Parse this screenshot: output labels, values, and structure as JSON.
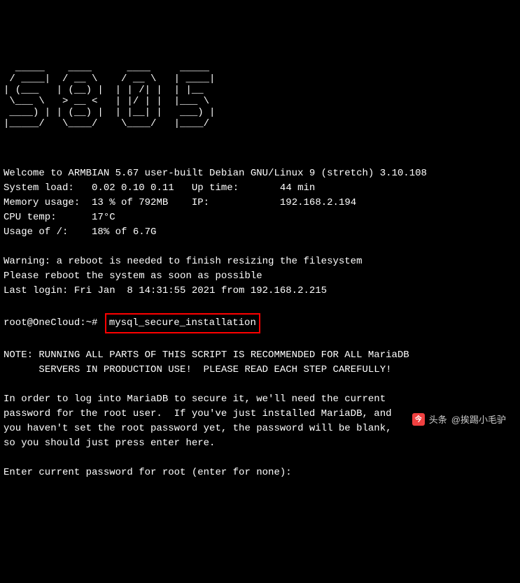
{
  "ascii_art": "  _____    ____      ____     _____ \n / ____|  / __ \\    / __ \\   | ____|\n| (___   | (__) |  | | /| |  | |__  \n \\___ \\   > __ <   | |/ | |  |___ \\ \n ____) | | (__) |  | |__| |   ___) |\n|_____/   \\____/    \\____/   |____/ ",
  "motd": {
    "welcome": "Welcome to ARMBIAN 5.67 user-built Debian GNU/Linux 9 (stretch) 3.10.108",
    "load_label": "System load:",
    "load_value": "0.02 0.10 0.11",
    "uptime_label": "Up time:",
    "uptime_value": "44 min",
    "mem_label": "Memory usage:",
    "mem_value": "13 % of 792MB",
    "ip_label": "IP:",
    "ip_value": "192.168.2.194",
    "cpu_label": "CPU temp:",
    "cpu_value": "17°C",
    "disk_label": "Usage of /:",
    "disk_value": "18% of 6.7G"
  },
  "warning_line1": "Warning: a reboot is needed to finish resizing the filesystem",
  "warning_line2": "Please reboot the system as soon as possible",
  "last_login": "Last login: Fri Jan  8 14:31:55 2021 from 192.168.2.215",
  "prompt": "root@OneCloud:~#",
  "command": "mysql_secure_installation",
  "note_line1": "NOTE: RUNNING ALL PARTS OF THIS SCRIPT IS RECOMMENDED FOR ALL MariaDB",
  "note_line2": "      SERVERS IN PRODUCTION USE!  PLEASE READ EACH STEP CAREFULLY!",
  "body1": "In order to log into MariaDB to secure it, we'll need the current",
  "body2": "password for the root user.  If you've just installed MariaDB, and",
  "body3": "you haven't set the root password yet, the password will be blank,",
  "body4": "so you should just press enter here.",
  "prompt_password": "Enter current password for root (enter for none):",
  "watermark_brand": "头条",
  "watermark_user": "@挨踢小毛驴"
}
